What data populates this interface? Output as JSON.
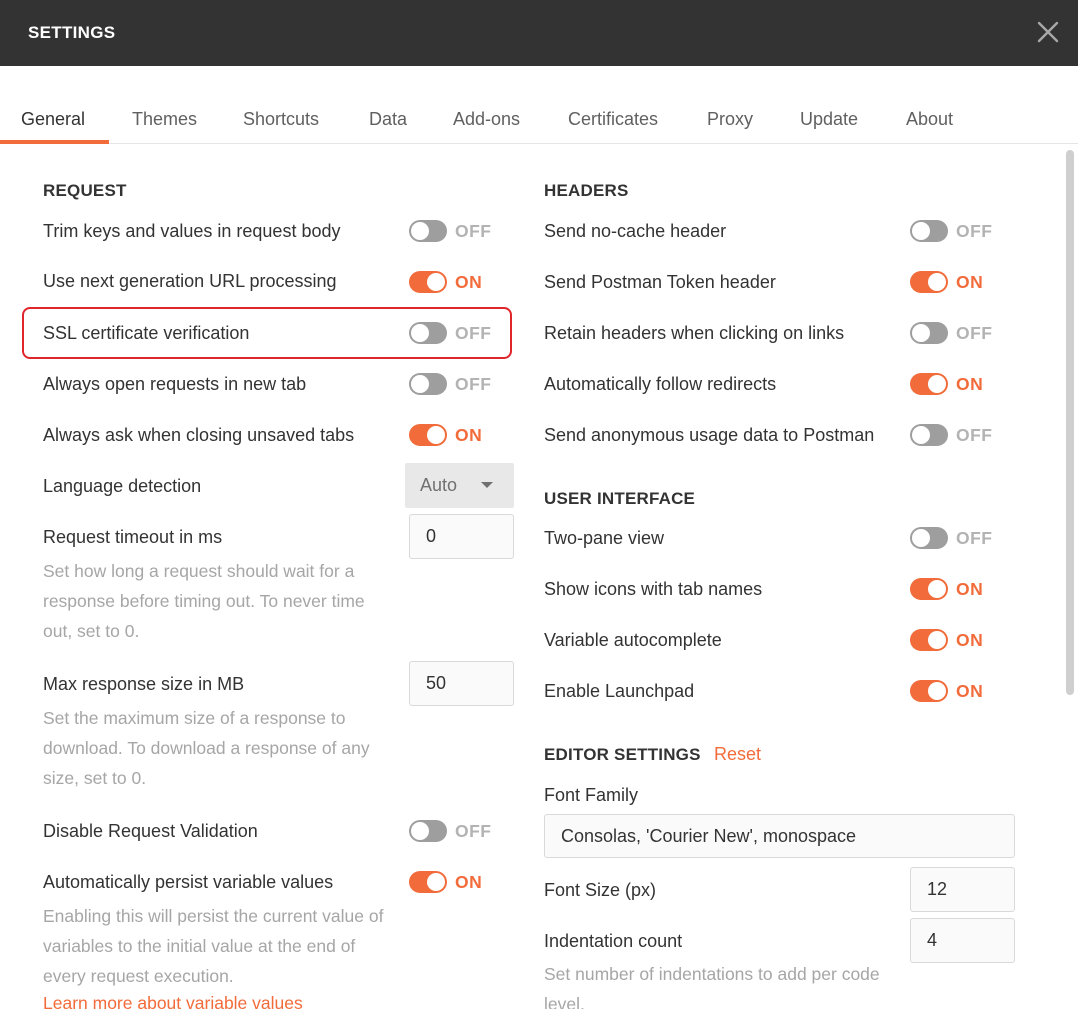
{
  "window": {
    "title": "SETTINGS"
  },
  "tabs": [
    {
      "label": "General"
    },
    {
      "label": "Themes"
    },
    {
      "label": "Shortcuts"
    },
    {
      "label": "Data"
    },
    {
      "label": "Add-ons"
    },
    {
      "label": "Certificates"
    },
    {
      "label": "Proxy"
    },
    {
      "label": "Update"
    },
    {
      "label": "About"
    }
  ],
  "active_tab": "General",
  "request": {
    "title": "REQUEST",
    "trim": {
      "label": "Trim keys and values in request body",
      "state": "OFF"
    },
    "next_gen_url": {
      "label": "Use next generation URL processing",
      "state": "ON"
    },
    "ssl": {
      "label": "SSL certificate verification",
      "state": "OFF"
    },
    "new_tab": {
      "label": "Always open requests in new tab",
      "state": "OFF"
    },
    "ask_closing": {
      "label": "Always ask when closing unsaved tabs",
      "state": "ON"
    },
    "language": {
      "label": "Language detection",
      "value": "Auto"
    },
    "timeout": {
      "label": "Request timeout in ms",
      "value": "0",
      "desc": "Set how long a request should wait for a response before timing out. To never time out, set to 0."
    },
    "max_size": {
      "label": "Max response size in MB",
      "value": "50",
      "desc": "Set the maximum size of a response to download. To download a response of any size, set to 0."
    },
    "disable_validation": {
      "label": "Disable Request Validation",
      "state": "OFF"
    },
    "persist_vars": {
      "label": "Automatically persist variable values",
      "state": "ON",
      "desc": "Enabling this will persist the current value of variables to the initial value at the end of every request execution.",
      "link": "Learn more about variable values"
    }
  },
  "headers": {
    "title": "HEADERS",
    "no_cache": {
      "label": "Send no-cache header",
      "state": "OFF"
    },
    "postman_token": {
      "label": "Send Postman Token header",
      "state": "ON"
    },
    "retain_headers": {
      "label": "Retain headers when clicking on links",
      "state": "OFF"
    },
    "follow_redirects": {
      "label": "Automatically follow redirects",
      "state": "ON"
    },
    "anon_usage": {
      "label": "Send anonymous usage data to Postman",
      "state": "OFF"
    }
  },
  "ui": {
    "title": "USER INTERFACE",
    "two_pane": {
      "label": "Two-pane view",
      "state": "OFF"
    },
    "tab_icons": {
      "label": "Show icons with tab names",
      "state": "ON"
    },
    "var_autocomplete": {
      "label": "Variable autocomplete",
      "state": "ON"
    },
    "launchpad": {
      "label": "Enable Launchpad",
      "state": "ON"
    }
  },
  "editor": {
    "title": "EDITOR SETTINGS",
    "reset": "Reset",
    "font_family": {
      "label": "Font Family",
      "value": "Consolas, 'Courier New', monospace"
    },
    "font_size": {
      "label": "Font Size (px)",
      "value": "12"
    },
    "indentation": {
      "label": "Indentation count",
      "value": "4",
      "desc": "Set number of indentations to add per code level."
    }
  },
  "colors": {
    "accent": "#f26b3a",
    "titlebar": "#333333",
    "toggle_off": "#9e9e9e",
    "highlight": "#e0252b"
  }
}
